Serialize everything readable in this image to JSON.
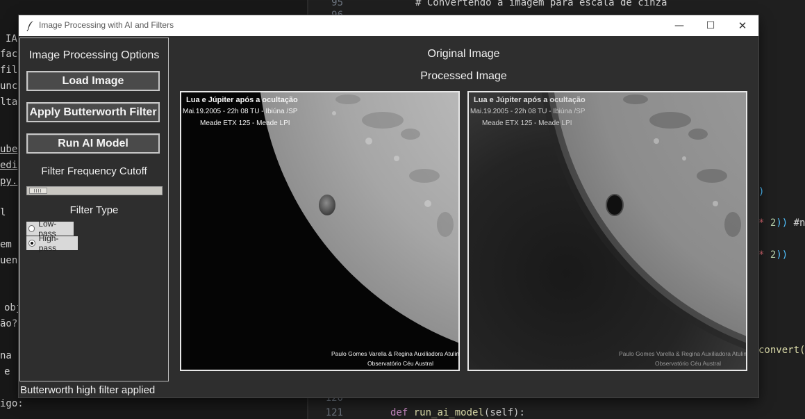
{
  "window": {
    "title": "Image Processing with AI and Filters",
    "minimize_glyph": "—",
    "maximize_glyph": "☐",
    "close_glyph": "✕"
  },
  "sidebar": {
    "heading": "Image Processing Options",
    "buttons": {
      "load": "Load Image",
      "butterworth": "Apply Butterworth Filter",
      "ai": "Run AI Model"
    },
    "cutoff_label": "Filter Frequency Cutoff",
    "cutoff_value_fraction": 0.1,
    "filter_type_label": "Filter Type",
    "filter_options": [
      {
        "label": "Low-pass",
        "selected": false
      },
      {
        "label": "High-pass",
        "selected": true
      }
    ]
  },
  "main": {
    "original_label": "Original Image",
    "processed_label": "Processed Image",
    "image_caption": {
      "line1": "Lua e Júpiter após a ocultação",
      "line2": "Mai.19.2005 - 22h 08 TU - Ibiúna /SP",
      "line3": "Meade ETX 125 - Meade LPI",
      "credit1": "Paulo Gomes Varella & Regina Auxiliadora Atulim",
      "credit2": "Observatório Céu Austral"
    }
  },
  "status": "Butterworth high filter applied",
  "background_editor": {
    "line_numbers": [
      "95",
      "96",
      "120",
      "121"
    ],
    "code_top": "# Convertendo a imagem para escala de cinza",
    "code_bottom": "def run_ai_model(self):",
    "fragments_left": [
      "IA",
      "fac",
      "fil",
      "unc",
      "lta",
      "ube",
      "edi",
      "py.",
      "l",
      "em",
      "uen",
      "obj",
      "ão?",
      "na",
      "e",
      "igo:"
    ],
    "fragments_right": [
      ")",
      "* 2)) #n",
      "* 2))",
      "convert("
    ]
  },
  "colors": {
    "window_bg": "#2e2e2e",
    "button_bg": "#4a4a4a",
    "editor_bg": "#1f1f1f"
  }
}
